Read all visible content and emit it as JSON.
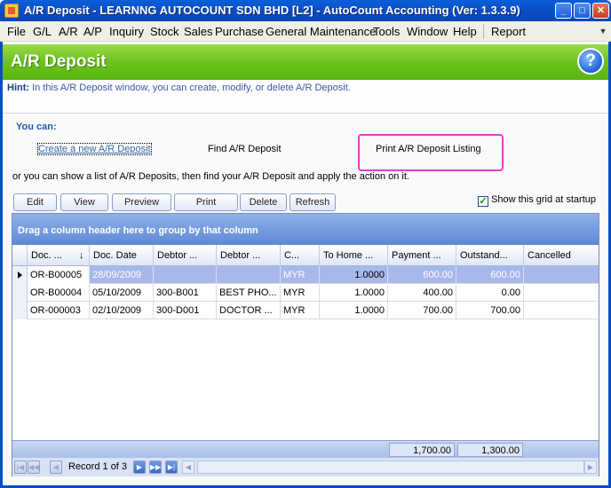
{
  "window": {
    "title": "A/R Deposit - LEARNNG AUTOCOUNT SDN BHD [L2] - AutoCount Accounting (Ver: 1.3.3.9)",
    "minimize": "_",
    "maximize": "□",
    "close": "✕"
  },
  "menu": {
    "items": [
      "File",
      "G/L",
      "A/R",
      "A/P",
      "Inquiry",
      "Stock",
      "Sales",
      "Purchase",
      "General Maintenance",
      "Tools",
      "Window",
      "Help"
    ],
    "report": "Report",
    "overflow": "▼"
  },
  "header": {
    "title": "A/R Deposit",
    "help": "?"
  },
  "hint": {
    "label": "Hint:",
    "text": "In this A/R Deposit window, you can create, modify, or delete A/R Deposit."
  },
  "actions": {
    "you_can": "You can:",
    "create": "Create a new A/R Deposit",
    "find": "Find A/R Deposit",
    "print_listing": "Print A/R Deposit Listing",
    "or_text": "or you can show a list of A/R Deposits, then find your A/R Deposit and apply the action on it."
  },
  "toolbar": {
    "edit": "Edit",
    "view": "View",
    "preview": "Preview",
    "print": "Print",
    "delete": "Delete",
    "refresh": "Refresh",
    "show_grid": "Show this grid at startup",
    "show_grid_checked": true
  },
  "grid": {
    "group_hint": "Drag a column header here to group by that column",
    "columns": [
      "Doc. ...",
      "Doc. Date",
      "Debtor ...",
      "Debtor ...",
      "C...",
      "To Home ...",
      "Payment ...",
      "Outstand...",
      "Cancelled"
    ],
    "sort_indicator": "↓",
    "rows": [
      [
        "OR-B00005",
        "28/09/2009",
        "",
        "",
        "MYR",
        "1.0000",
        "600.00",
        "600.00",
        ""
      ],
      [
        "OR-B00004",
        "05/10/2009",
        "300-B001",
        "BEST PHO...",
        "MYR",
        "1.0000",
        "400.00",
        "0.00",
        ""
      ],
      [
        "OR-000003",
        "02/10/2009",
        "300-D001",
        "DOCTOR ...",
        "MYR",
        "1.0000",
        "700.00",
        "700.00",
        ""
      ]
    ],
    "totals": {
      "payment": "1,700.00",
      "outstanding": "1,300.00"
    },
    "nav": {
      "record_text": "Record 1 of 3"
    }
  }
}
